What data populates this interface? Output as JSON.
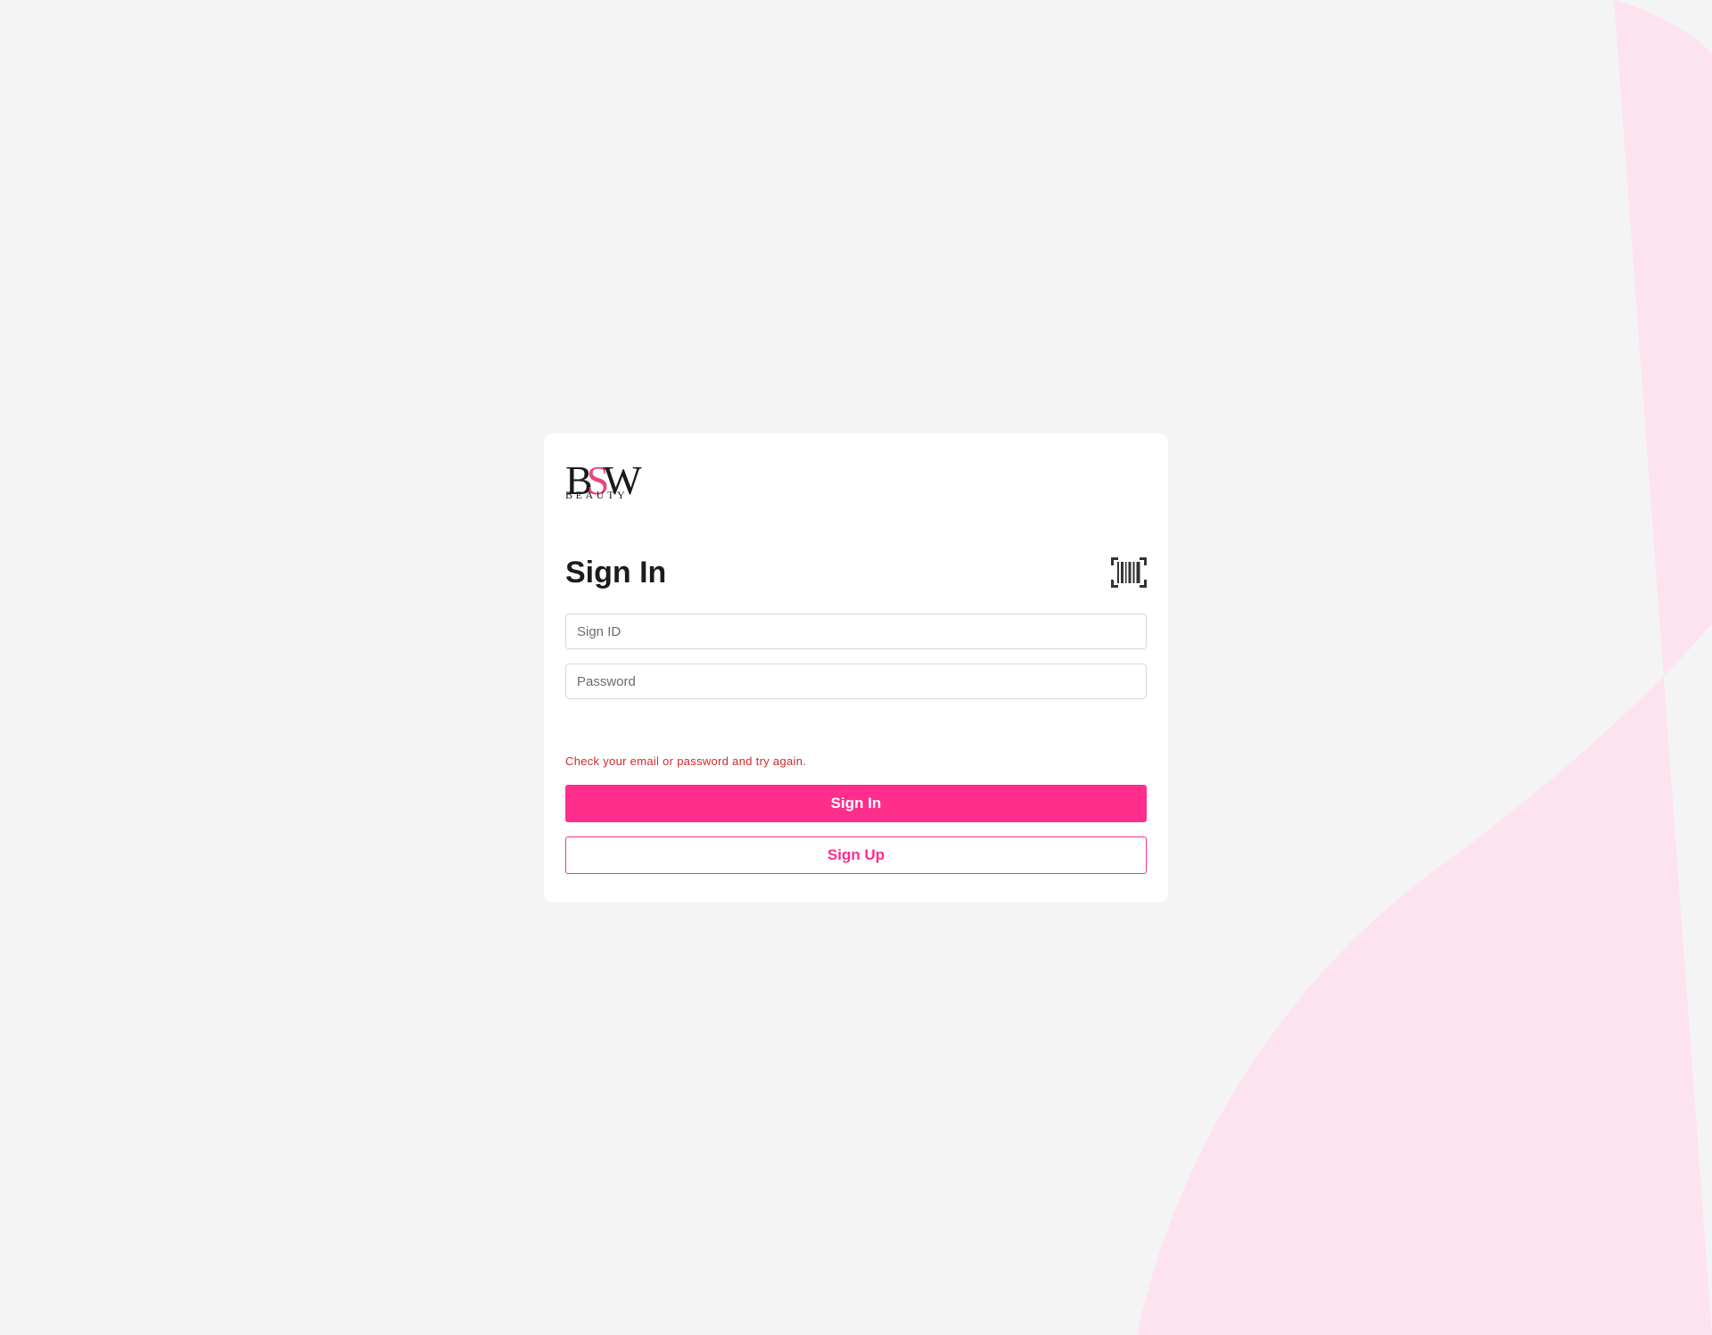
{
  "brand": {
    "logo_main": "BSW",
    "logo_sub": "BEAUTY",
    "accent_color": "#ff2d8c",
    "background_shape_color": "#fde3ef"
  },
  "signin": {
    "title": "Sign In",
    "barcode_icon": "barcode-scan-icon",
    "sign_id_placeholder": "Sign ID",
    "password_placeholder": "Password",
    "error_message": "Check your email or password and try again.",
    "sign_in_label": "Sign In",
    "sign_up_label": "Sign Up"
  }
}
